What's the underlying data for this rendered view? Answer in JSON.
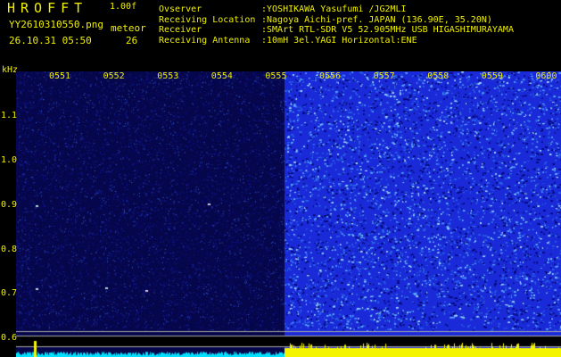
{
  "header": {
    "brand": "HROFFT",
    "version": "1.00f",
    "filename": "YY2610310550.png",
    "datetime": "26.10.31 05:50",
    "meteor_label": "meteor",
    "meteor_count": "26"
  },
  "info": [
    {
      "key": "Ovserver",
      "value": ":YOSHIKAWA Yasufumi /JG2MLI"
    },
    {
      "key": "Receiving Location",
      "value": ":Nagoya Aichi-pref. JAPAN (136.90E, 35.20N)"
    },
    {
      "key": "Receiver",
      "value": ":SMArt RTL-SDR V5 52.905MHz USB HIGASHIMURAYAMA"
    },
    {
      "key": "Receiving Antenna",
      "value": ":10mH 3el.YAGI Horizontal:ENE"
    }
  ],
  "spectrogram": {
    "y_unit": "kHz",
    "y_ticks": [
      "1.1",
      "1.0",
      "0.9",
      "0.8",
      "0.7",
      "0.6"
    ],
    "time_ticks": [
      "0551",
      "0552",
      "0553",
      "0554",
      "0555",
      "0556",
      "0557",
      "0558",
      "0559",
      "0600"
    ],
    "colors": {
      "background_quiet": "#06064a",
      "background_noisy": "#1a2ad8",
      "noise_bright": "#9fd8ff",
      "strip": "#f4f400",
      "trace": "#00e0ff"
    }
  }
}
